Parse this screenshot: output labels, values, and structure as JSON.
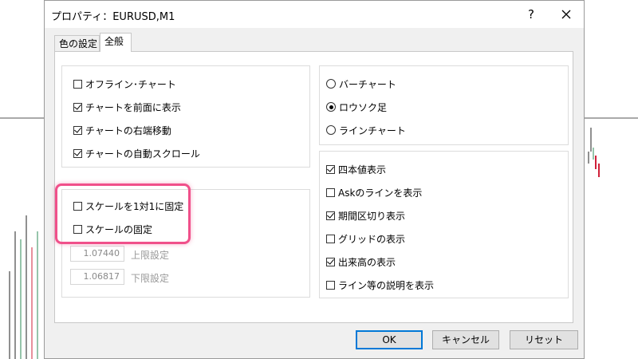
{
  "window": {
    "title": "プロパティ：EURUSD,M1",
    "help_label": "?",
    "close_icon": "close-icon"
  },
  "tabs": [
    {
      "label": "色の設定",
      "active": false
    },
    {
      "label": "全般",
      "active": true
    }
  ],
  "chart_options": [
    {
      "label": "オフライン･チャート",
      "checked": false
    },
    {
      "label": "チャートを前面に表示",
      "checked": true
    },
    {
      "label": "チャートの右端移動",
      "checked": true
    },
    {
      "label": "チャートの自動スクロール",
      "checked": true
    }
  ],
  "scale_options": [
    {
      "label": "スケールを1対1に固定",
      "checked": false
    },
    {
      "label": "スケールの固定",
      "checked": false
    }
  ],
  "scale_limits": {
    "upper_value": "1.07440",
    "upper_label": "上限設定",
    "lower_value": "1.06817",
    "lower_label": "下限設定"
  },
  "chart_type": [
    {
      "label": "バーチャート",
      "selected": false
    },
    {
      "label": "ロウソク足",
      "selected": true
    },
    {
      "label": "ラインチャート",
      "selected": false
    }
  ],
  "display_options": [
    {
      "label": "四本値表示",
      "checked": true
    },
    {
      "label": "Askのラインを表示",
      "checked": false
    },
    {
      "label": "期間区切り表示",
      "checked": true
    },
    {
      "label": "グリッドの表示",
      "checked": false
    },
    {
      "label": "出来高の表示",
      "checked": true
    },
    {
      "label": "ライン等の説明を表示",
      "checked": false
    }
  ],
  "buttons": {
    "ok": "OK",
    "cancel": "キャンセル",
    "reset": "リセット"
  },
  "colors": {
    "highlight": "#f0508a",
    "candle_up": "#2e8b57",
    "candle_down": "#d0213a"
  }
}
